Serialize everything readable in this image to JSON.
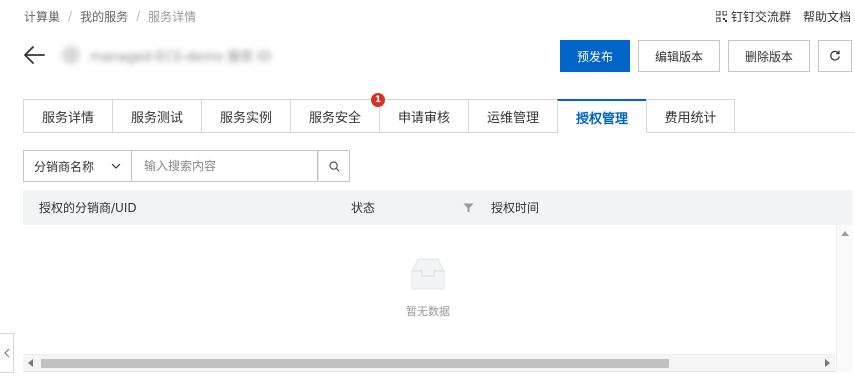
{
  "breadcrumb": {
    "items": [
      "计算巢",
      "我的服务",
      "服务详情"
    ],
    "separator": "/"
  },
  "top_links": {
    "dingtalk_group": "钉钉交流群",
    "help_docs": "帮助文档"
  },
  "header": {
    "title_blurred": "managed-ECS-demo  服务 ID",
    "buttons": {
      "prerelease": "预发布",
      "edit_version": "编辑版本",
      "delete_version": "删除版本"
    }
  },
  "tabs": [
    {
      "label": "服务详情"
    },
    {
      "label": "服务测试"
    },
    {
      "label": "服务实例"
    },
    {
      "label": "服务安全",
      "badge": "1"
    },
    {
      "label": "申请审核"
    },
    {
      "label": "运维管理"
    },
    {
      "label": "授权管理",
      "active": true
    },
    {
      "label": "费用统计"
    }
  ],
  "search": {
    "filter_selected": "分销商名称",
    "placeholder": "输入搜索内容"
  },
  "table": {
    "columns": [
      "授权的分销商/UID",
      "状态",
      "授权时间"
    ],
    "empty_text": "暂无数据"
  },
  "colors": {
    "primary": "#0064c8",
    "badge": "#d93026"
  },
  "icons": [
    "back-arrow-icon",
    "qrcode-icon",
    "refresh-icon",
    "chevron-down-icon",
    "search-icon",
    "filter-icon",
    "empty-box-icon",
    "chevron-left-icon"
  ]
}
